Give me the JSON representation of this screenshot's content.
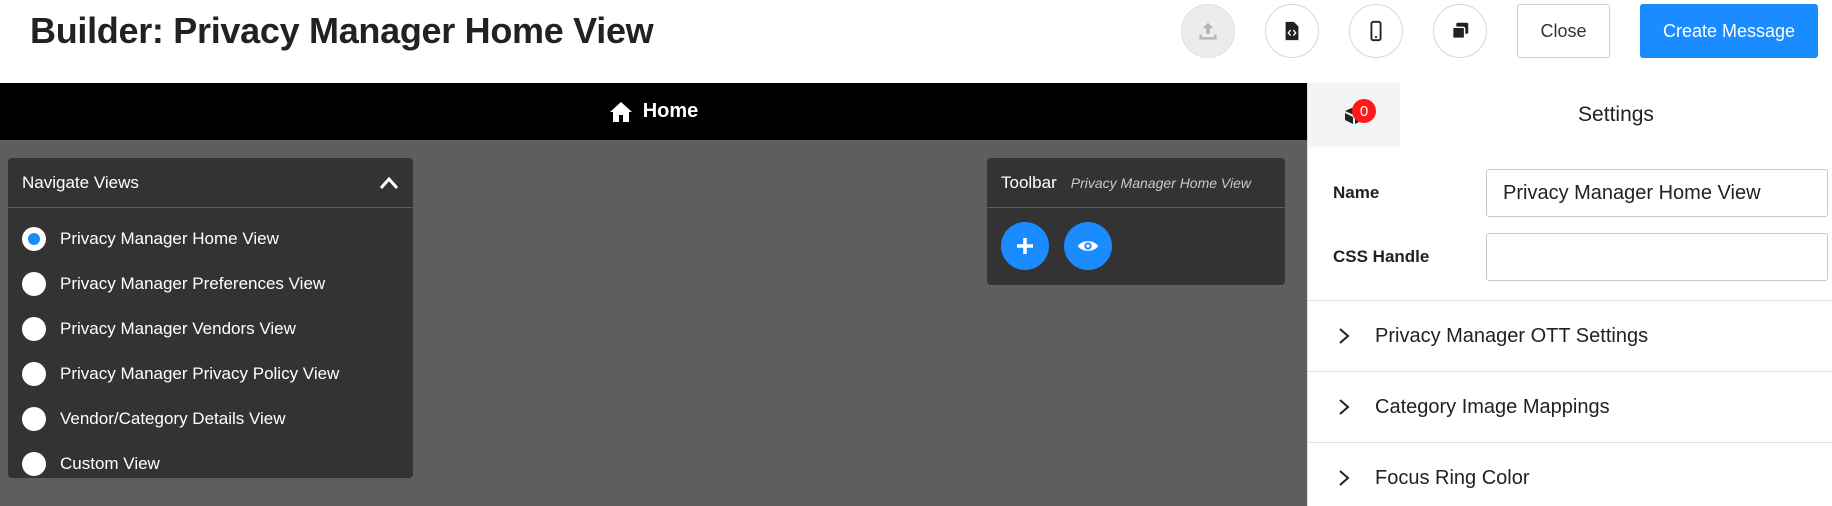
{
  "header": {
    "title": "Builder: Privacy Manager Home View",
    "icons": [
      "upload-icon",
      "code-file-icon",
      "mobile-icon",
      "copy-icon"
    ],
    "close_label": "Close",
    "create_label": "Create Message"
  },
  "canvas": {
    "home_label": "Home",
    "nav": {
      "title": "Navigate Views",
      "items": [
        {
          "label": "Privacy Manager Home View",
          "selected": true
        },
        {
          "label": "Privacy Manager Preferences View",
          "selected": false
        },
        {
          "label": "Privacy Manager Vendors View",
          "selected": false
        },
        {
          "label": "Privacy Manager Privacy Policy View",
          "selected": false
        },
        {
          "label": "Vendor/Category Details View",
          "selected": false
        },
        {
          "label": "Custom View",
          "selected": false
        }
      ]
    },
    "toolbar": {
      "title": "Toolbar",
      "subtitle": "Privacy Manager Home View"
    }
  },
  "sidebar": {
    "badge_count": "0",
    "tab_label": "Settings",
    "name_label": "Name",
    "name_value": "Privacy Manager Home View",
    "css_label": "CSS Handle",
    "css_value": "",
    "sections": [
      "Privacy Manager OTT Settings",
      "Category Image Mappings",
      "Focus Ring Color"
    ]
  },
  "colors": {
    "accent": "#1a8cff",
    "canvas_bg": "#5e5e5e",
    "panel_bg": "#333333",
    "badge": "#ff1a1a"
  }
}
